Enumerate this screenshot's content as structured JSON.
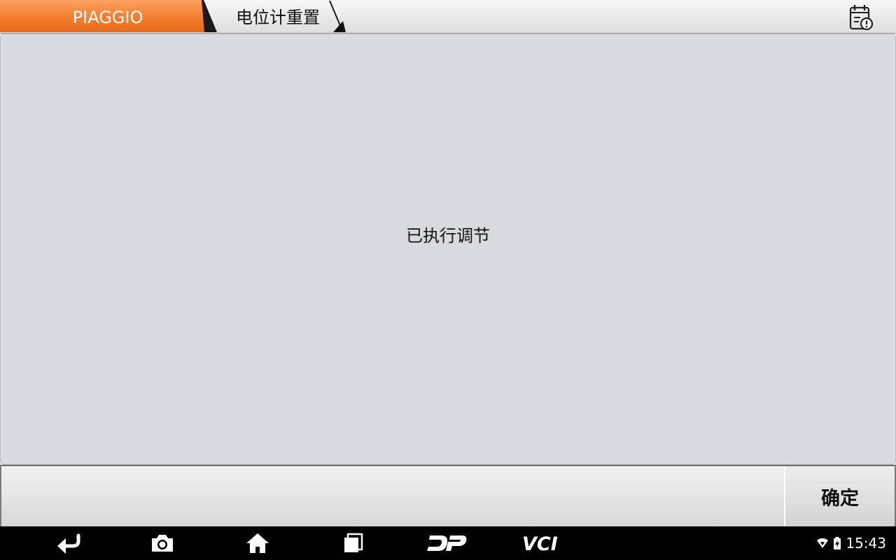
{
  "breadcrumb": {
    "root_label": "PIAGGIO",
    "current_label": "电位计重置",
    "root_color": "#f47e2e"
  },
  "header": {
    "report_icon": "clipboard-alert-icon"
  },
  "main": {
    "message": "已执行调节"
  },
  "actions": {
    "confirm_label": "确定"
  },
  "navbar": {
    "buttons": [
      {
        "name": "back",
        "icon": "back-arrow-icon"
      },
      {
        "name": "screenshot",
        "icon": "camera-icon"
      },
      {
        "name": "home",
        "icon": "home-icon"
      },
      {
        "name": "recents",
        "icon": "recent-apps-icon"
      },
      {
        "name": "dp",
        "label": "DP"
      },
      {
        "name": "vci",
        "label": "VCI"
      }
    ],
    "status": {
      "wifi_icon": "wifi-icon",
      "battery_icon": "battery-charging-icon",
      "time": "15:43"
    }
  }
}
